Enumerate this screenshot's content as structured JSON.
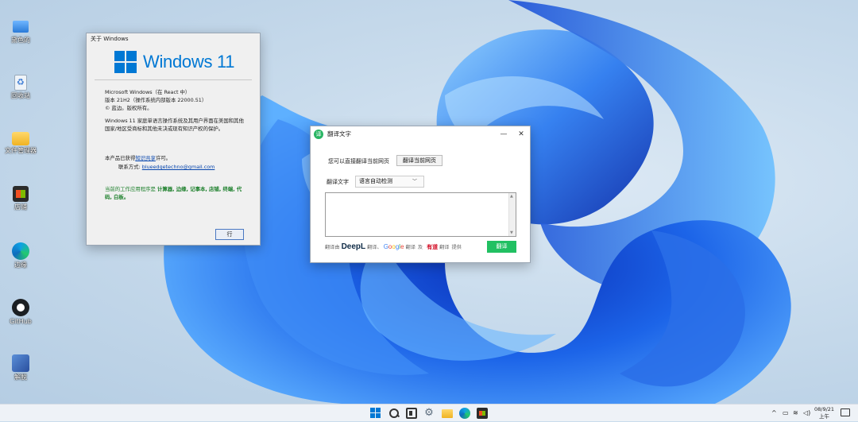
{
  "desktop": {
    "icons": [
      {
        "label": "黛色的",
        "icon": "computer-icon"
      },
      {
        "label": "回收站",
        "icon": "recycle-bin-icon"
      },
      {
        "label": "文件管理器",
        "icon": "folder-icon"
      },
      {
        "label": "店铺",
        "icon": "store-icon"
      },
      {
        "label": "边缘",
        "icon": "edge-icon"
      },
      {
        "label": "GitHub",
        "icon": "github-icon"
      },
      {
        "label": "解脱",
        "icon": "unzip-icon"
      }
    ]
  },
  "about_window": {
    "title": "关于 Windows",
    "logo_text": "Windows 11",
    "line1": "Microsoft Windows（在 React 中）",
    "line2": "版本 21H2（操作系统内部版本 22000.51）",
    "line3": "© 蓝边。版权所有。",
    "paragraph": "Windows 11 家庭单语言操作系统及其用户界面在美国和其他国家/地区受商标和其他未决或现有知识产权的保护。",
    "license_prefix": "本产品已获得",
    "license_link": "知识共享",
    "license_suffix": "许可。",
    "contact_label": "联系方式:",
    "contact_email": "blueedgetechno@gmail.com",
    "apps_prefix": "当前的工作应用程序是",
    "apps_list": "计算器, 边缘, 记事本, 店铺, 终端, 代码, 白板。",
    "ok_label": "行"
  },
  "translate_window": {
    "title": "翻译文字",
    "logo_letter": "译",
    "minimize": "—",
    "close": "✕",
    "direct_label": "您可以直接翻译当前网页",
    "translate_page_button": "翻译当前网页",
    "text_label": "翻译文字",
    "language_select": "语言自动检测",
    "text_value": "",
    "footer_prefix": "翻译由",
    "deepl": "DeepL",
    "footer_mid1": "翻译、",
    "google_G": "G",
    "google_o1": "o",
    "google_o2": "o",
    "google_g": "g",
    "google_l": "l",
    "google_e": "e",
    "footer_mid2": "翻译",
    "footer_and": "及",
    "youdao": "有道",
    "footer_mid3": "翻译",
    "footer_suffix": "提供",
    "translate_button": "翻译"
  },
  "taskbar": {
    "tray_chevron": "^",
    "clock_date": "08/9/21",
    "clock_time": "上午"
  },
  "colors": {
    "accent": "#0078d4",
    "translate_green": "#21c062",
    "link_blue": "#0645ad",
    "apps_green": "#1b7f2a"
  }
}
